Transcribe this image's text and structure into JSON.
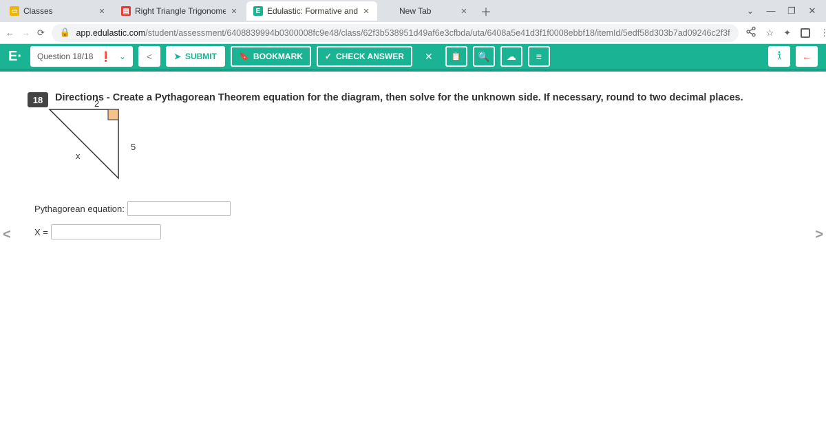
{
  "tabs": [
    {
      "title": "Classes",
      "favicon_bg": "#f0b500",
      "favicon_txt": "",
      "active": false
    },
    {
      "title": "Right Triangle Trigonometry Revi",
      "favicon_bg": "#e53935",
      "favicon_txt": "",
      "active": false
    },
    {
      "title": "Edulastic: Formative and Summa",
      "favicon_bg": "#1ab394",
      "favicon_txt": "E",
      "active": true
    },
    {
      "title": "New Tab",
      "favicon_bg": "transparent",
      "favicon_txt": "",
      "active": false
    }
  ],
  "address": {
    "lock": "🔒",
    "domain": "app.edulastic.com",
    "path": "/student/assessment/6408839994b0300008fc9e48/class/62f3b538951d49af6e3cfbda/uta/6408a5e41d3f1f0008ebbf18/itemId/5edf58d303b7ad09246c2f3f"
  },
  "edu": {
    "logo": "E·",
    "question_label": "Question 18/18",
    "submit": "SUBMIT",
    "bookmark": "BOOKMARK",
    "check": "CHECK ANSWER"
  },
  "question": {
    "number": "18",
    "directions": "Directions - Create a Pythagorean Theorem equation for the diagram, then solve for the unknown side. If necessary, round to two decimal places.",
    "top_label": "2",
    "hyp_label": "5",
    "side_label": "x",
    "eq_label": "Pythagorean equation:",
    "x_label": "X ="
  }
}
